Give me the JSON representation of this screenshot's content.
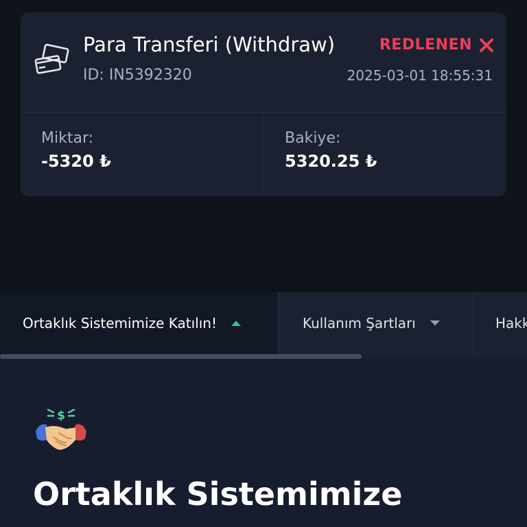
{
  "transaction": {
    "icon": "credit-cards-icon",
    "title": "Para Transferi (Withdraw)",
    "id_label": "ID: IN5392320",
    "status": "REDLENEN",
    "status_icon": "close-icon",
    "status_color": "#e8405a",
    "date": "2025-03-01 18:55:31",
    "amount_label": "Miktar:",
    "amount_value": "-5320 ₺",
    "balance_label": "Bakiye:",
    "balance_value": "5320.25 ₺"
  },
  "tabs": [
    {
      "label": "Ortaklık Sistemimize Katılın!",
      "icon": "caret-up-icon",
      "active": true,
      "accent": "#2fc98f"
    },
    {
      "label": "Kullanım Şartları",
      "icon": "caret-down-icon",
      "active": false
    },
    {
      "label": "Hakk",
      "active": false
    }
  ],
  "content": {
    "icon": "handshake-icon",
    "title": "Ortaklık Sistemimize"
  }
}
